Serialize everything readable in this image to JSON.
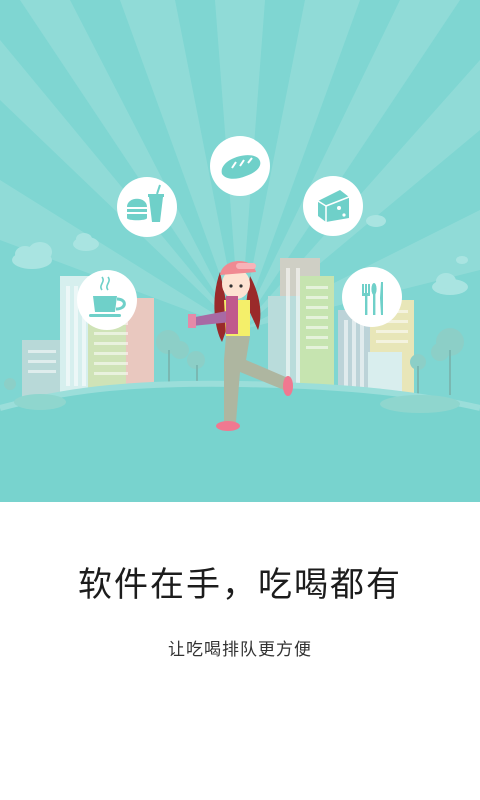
{
  "onboarding": {
    "headline": "软件在手，吃喝都有",
    "subline": "让吃喝排队更方便"
  },
  "illustration": {
    "background_color": "#7fd6d2",
    "icons": [
      "coffee-cup-icon",
      "burger-drink-icon",
      "bread-icon",
      "cake-slice-icon",
      "cutlery-icon"
    ]
  }
}
